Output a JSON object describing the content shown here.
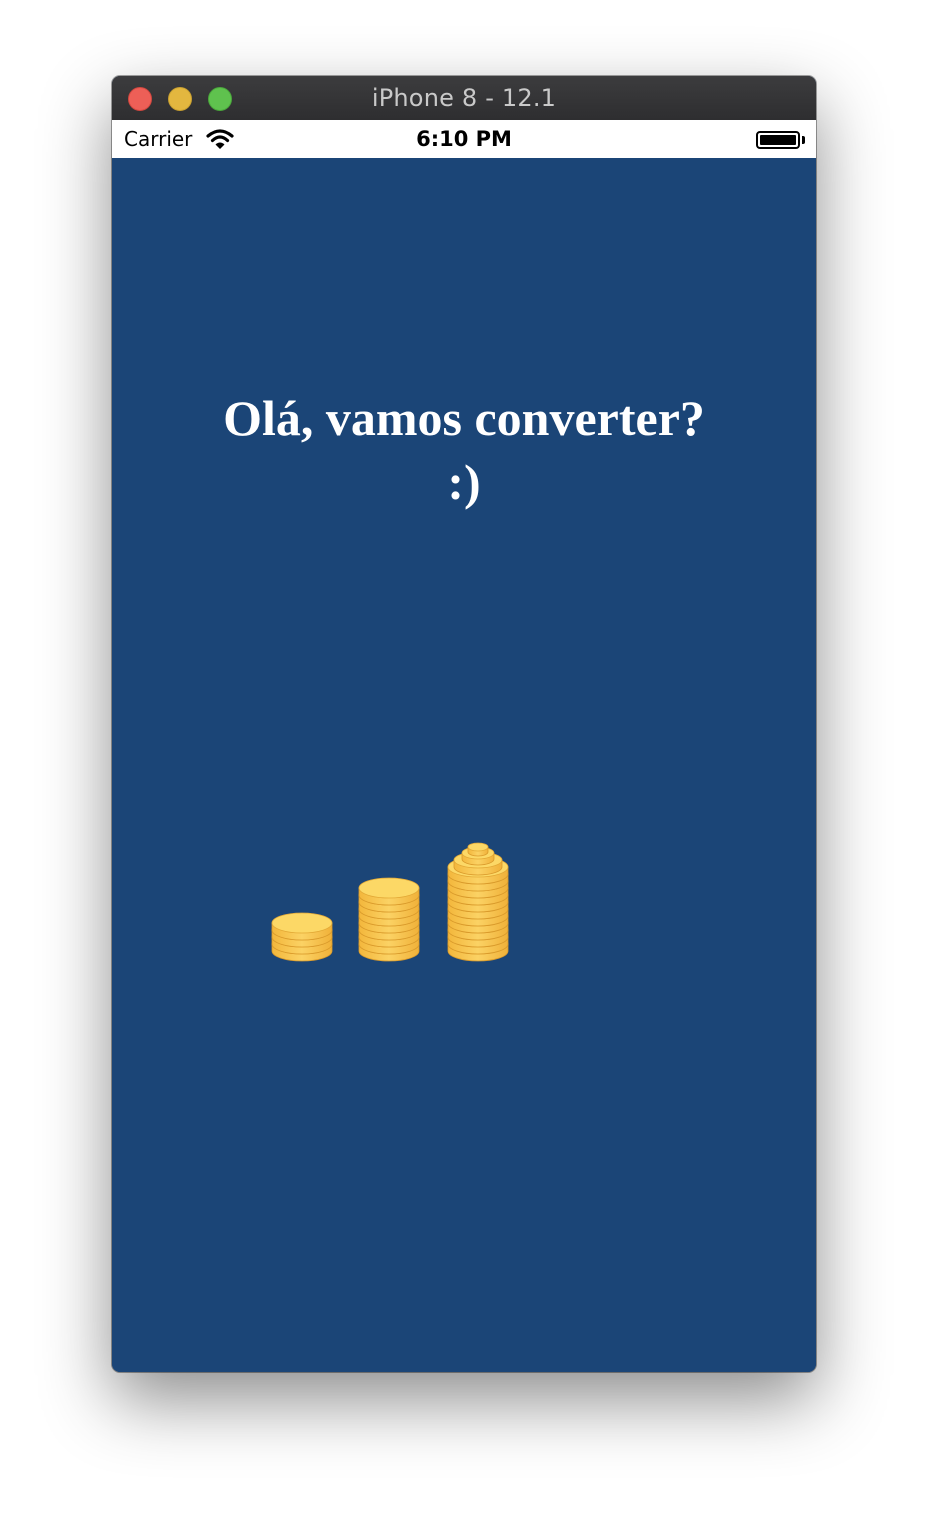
{
  "window": {
    "title": "iPhone 8 - 12.1"
  },
  "status_bar": {
    "carrier": "Carrier",
    "time": "6:10 PM",
    "icons": [
      "wifi-icon",
      "battery-icon"
    ]
  },
  "screen": {
    "greeting_line1": "Olá, vamos converter?",
    "greeting_line2": ":)",
    "illustration": "coin-stacks-icon"
  },
  "colors": {
    "background": "#1b4577",
    "text": "#ffffff",
    "coin": "#f9c84a"
  }
}
